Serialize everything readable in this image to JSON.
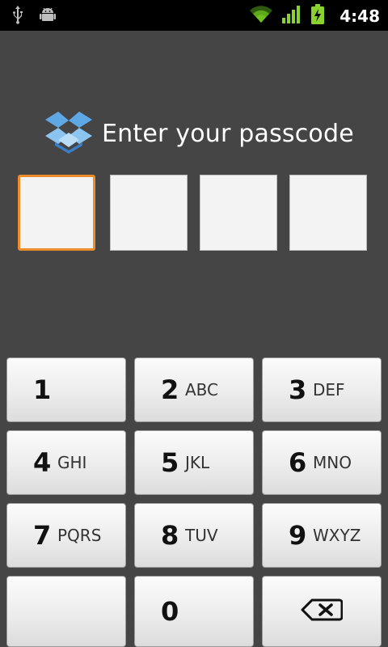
{
  "status_bar": {
    "time": "4:48",
    "icons": [
      "usb-icon",
      "android-debug-icon",
      "wifi-icon",
      "signal-icon",
      "battery-charging-icon"
    ]
  },
  "header": {
    "title": "Enter your passcode",
    "logo": "dropbox-logo-icon"
  },
  "passcode": {
    "slot_count": 4,
    "filled": 0,
    "active_slot": 1
  },
  "keypad": {
    "keys": [
      {
        "digit": "1",
        "letters": ""
      },
      {
        "digit": "2",
        "letters": "ABC"
      },
      {
        "digit": "3",
        "letters": "DEF"
      },
      {
        "digit": "4",
        "letters": "GHI"
      },
      {
        "digit": "5",
        "letters": "JKL"
      },
      {
        "digit": "6",
        "letters": "MNO"
      },
      {
        "digit": "7",
        "letters": "PQRS"
      },
      {
        "digit": "8",
        "letters": "TUV"
      },
      {
        "digit": "9",
        "letters": "WXYZ"
      },
      {
        "digit": "",
        "letters": ""
      },
      {
        "digit": "0",
        "letters": ""
      },
      {
        "digit": "",
        "letters": "",
        "icon": "backspace-icon"
      }
    ]
  },
  "colors": {
    "background": "#454545",
    "active_slot_border": "#ec8c2a",
    "wifi": "#6fbf1f",
    "battery": "#8bd130"
  }
}
